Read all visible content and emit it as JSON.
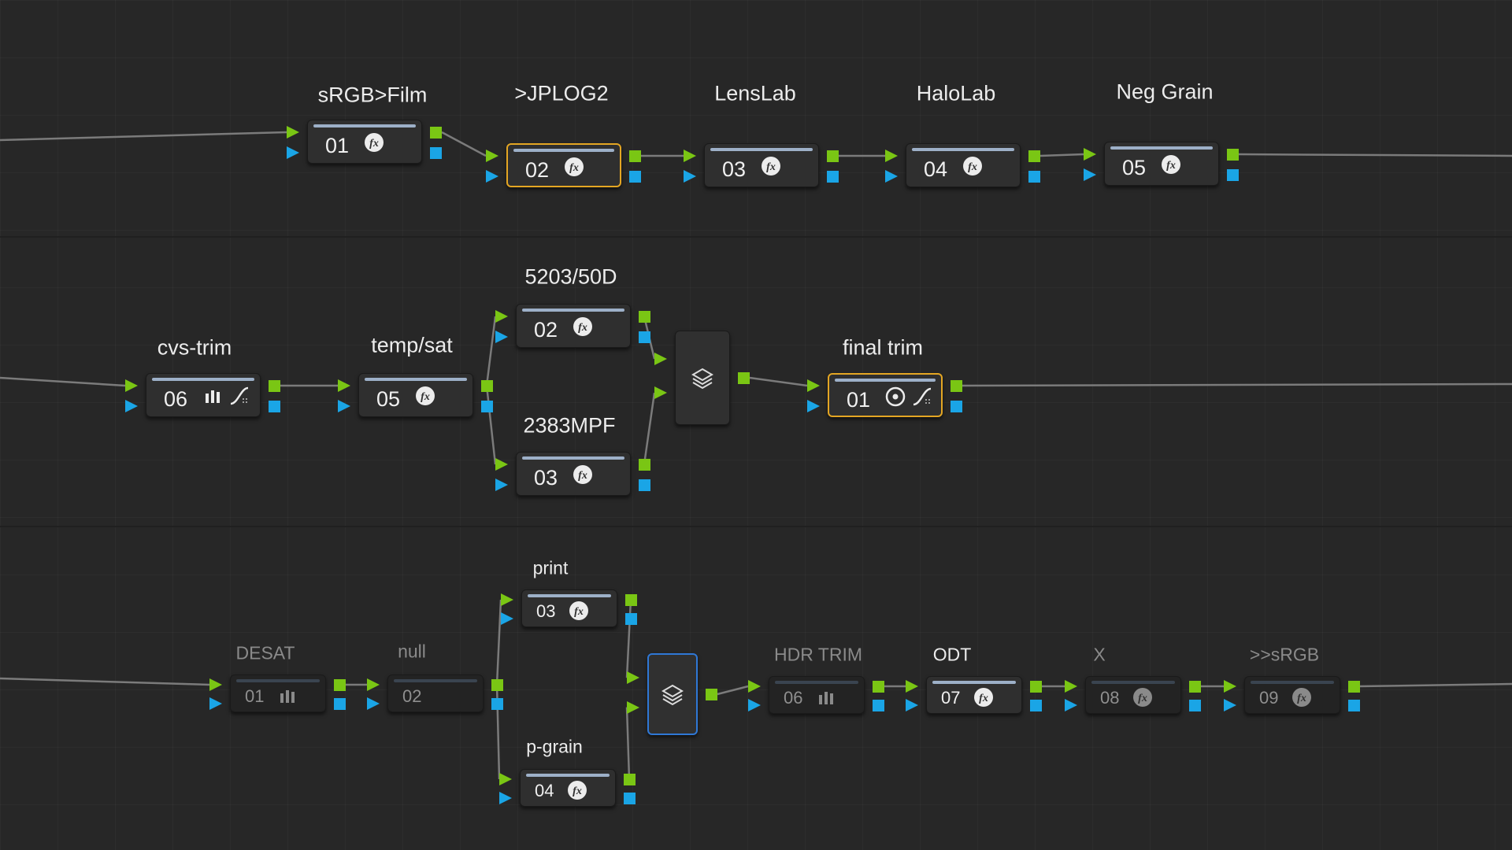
{
  "app": "DaVinci Resolve Color Page - Node Editor",
  "rows": [
    {
      "name": "row-1",
      "nodes": [
        {
          "label": "sRGB>Film",
          "number": "01",
          "icons": [
            "fx"
          ]
        },
        {
          "label": ">JPLOG2",
          "number": "02",
          "icons": [
            "fx"
          ],
          "selected": true
        },
        {
          "label": "LensLab",
          "number": "03",
          "icons": [
            "fx"
          ]
        },
        {
          "label": "HaloLab",
          "number": "04",
          "icons": [
            "fx"
          ]
        },
        {
          "label": "Neg Grain",
          "number": "05",
          "icons": [
            "fx"
          ]
        }
      ]
    },
    {
      "name": "row-2",
      "nodes": [
        {
          "label": "cvs-trim",
          "number": "06",
          "icons": [
            "bars",
            "curve"
          ]
        },
        {
          "label": "temp/sat",
          "number": "05",
          "icons": [
            "fx"
          ]
        },
        {
          "label": "5203/50D",
          "number": "02",
          "icons": [
            "fx"
          ]
        },
        {
          "label": "2383MPF",
          "number": "03",
          "icons": [
            "fx"
          ]
        },
        {
          "label": "final trim",
          "number": "01",
          "icons": [
            "circle",
            "curve"
          ],
          "selected": true
        }
      ],
      "mixer": {
        "icon": "layer-mixer"
      }
    },
    {
      "name": "row-3",
      "nodes": [
        {
          "label": "DESAT",
          "number": "01",
          "icons": [
            "bars"
          ],
          "disabled": true
        },
        {
          "label": "null",
          "number": "02",
          "icons": [],
          "disabled": true
        },
        {
          "label": "print",
          "number": "03",
          "icons": [
            "fx"
          ]
        },
        {
          "label": "p-grain",
          "number": "04",
          "icons": [
            "fx"
          ]
        },
        {
          "label": "HDR TRIM",
          "number": "06",
          "icons": [
            "bars"
          ],
          "disabled": true
        },
        {
          "label": "ODT",
          "number": "07",
          "icons": [
            "fx"
          ]
        },
        {
          "label": "X",
          "number": "08",
          "icons": [
            "fx"
          ],
          "disabled": true
        },
        {
          "label": ">>sRGB",
          "number": "09",
          "icons": [
            "fx"
          ],
          "disabled": true
        }
      ],
      "mixer": {
        "icon": "layer-mixer",
        "selected": true
      }
    }
  ],
  "colors": {
    "background": "#272727",
    "rgb_input": "#7ac614",
    "alpha_input": "#1aa5e6",
    "selected_outline": "#e4a623",
    "mixer_selected_outline": "#2f78d6",
    "connection_line": "#7b7b7b"
  }
}
